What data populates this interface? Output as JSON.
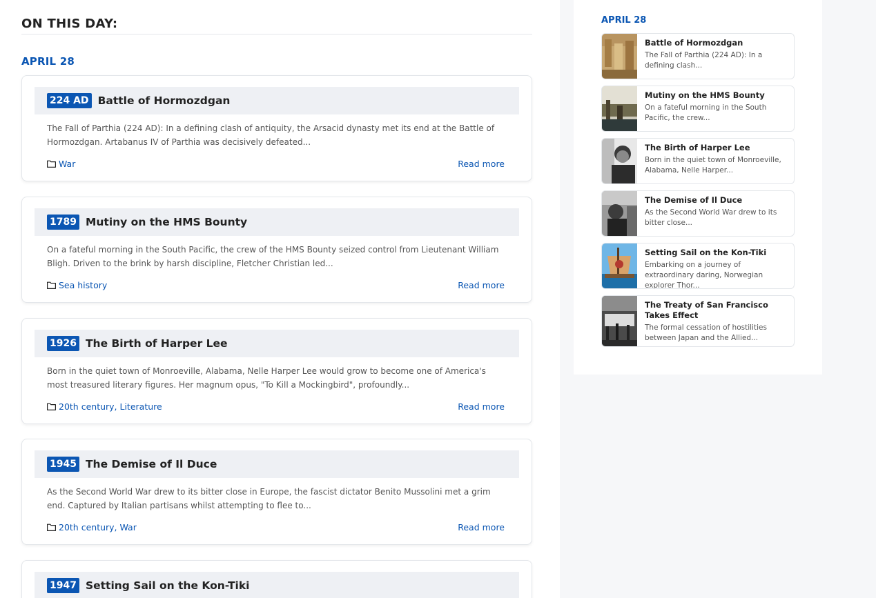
{
  "main": {
    "section_title": "ON THIS DAY:",
    "date_heading": "APRIL 28",
    "read_more_label": "Read more",
    "cards": [
      {
        "year": "224 AD",
        "title": "Battle of Hormozdgan",
        "excerpt": "The Fall of Parthia (224 AD): In a defining clash of antiquity, the Arsacid dynasty met its end at the Battle of Hormozdgan. Artabanus IV of Parthia was decisively defeated...",
        "categories": "War"
      },
      {
        "year": "1789",
        "title": "Mutiny on the HMS Bounty",
        "excerpt": "On a fateful morning in the South Pacific, the crew of the HMS Bounty seized control from Lieutenant William Bligh. Driven to the brink by harsh discipline, Fletcher Christian led...",
        "categories": "Sea history"
      },
      {
        "year": "1926",
        "title": "The Birth of Harper Lee",
        "excerpt": "Born in the quiet town of Monroeville, Alabama, Nelle Harper Lee would grow to become one of America's most treasured literary figures. Her magnum opus, \"To Kill a Mockingbird\", profoundly...",
        "categories": "20th century, Literature"
      },
      {
        "year": "1945",
        "title": "The Demise of Il Duce",
        "excerpt": "As the Second World War drew to its bitter close in Europe, the fascist dictator Benito Mussolini met a grim end. Captured by Italian partisans whilst attempting to flee to...",
        "categories": "20th century, War"
      },
      {
        "year": "1947",
        "title": "Setting Sail on the Kon-Tiki",
        "excerpt": "",
        "categories": ""
      }
    ]
  },
  "sidebar": {
    "date_heading": "APRIL 28",
    "items": [
      {
        "title": "Battle of Hormozdgan",
        "excerpt": "The Fall of Parthia (224 AD): In a defining clash..."
      },
      {
        "title": "Mutiny on the HMS Bounty",
        "excerpt": "On a fateful morning in the South Pacific, the crew..."
      },
      {
        "title": "The Birth of Harper Lee",
        "excerpt": "Born in the quiet town of Monroeville, Alabama, Nelle Harper..."
      },
      {
        "title": "The Demise of Il Duce",
        "excerpt": "As the Second World War drew to its bitter close..."
      },
      {
        "title": "Setting Sail on the Kon-Tiki",
        "excerpt": "Embarking on a journey of extraordinary daring, Norwegian explorer Thor..."
      },
      {
        "title": "The Treaty of San Francisco Takes Effect",
        "excerpt": "The formal cessation of hostilities between Japan and the Allied..."
      }
    ]
  },
  "colors": {
    "accent": "#0b56b3",
    "card_header_bg": "#eef0f4",
    "page_bg": "#f6f7f9"
  }
}
